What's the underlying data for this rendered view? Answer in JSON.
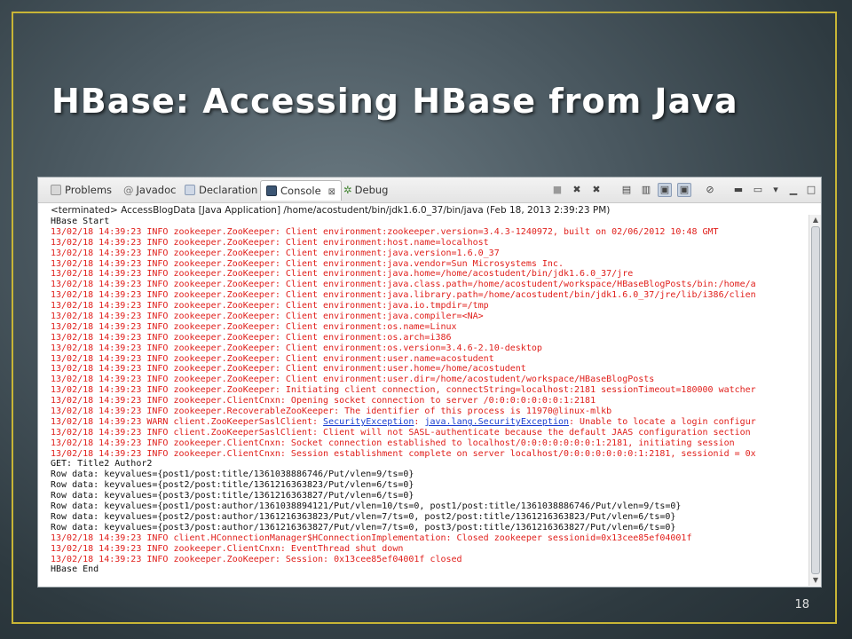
{
  "slide": {
    "title": "HBase: Accessing HBase from Java",
    "number": "18"
  },
  "eclipse": {
    "tabs": [
      {
        "label": "Problems",
        "icon": "problems-icon"
      },
      {
        "label": "Javadoc",
        "icon": "at-icon"
      },
      {
        "label": "Declaration",
        "icon": "declaration-icon"
      },
      {
        "label": "Console",
        "icon": "console-icon",
        "active": true,
        "close": "⊠"
      },
      {
        "label": "Debug",
        "icon": "debug-icon"
      }
    ],
    "terminated": "<terminated> AccessBlogData [Java Application] /home/acostudent/bin/jdk1.6.0_37/bin/java (Feb 18, 2013 2:39:23 PM)"
  },
  "console": {
    "colors": {
      "error": "#e0201c",
      "stdout": "#111111",
      "link": "#1b3fd1"
    },
    "lines": [
      {
        "type": "out",
        "text": "HBase Start"
      },
      {
        "type": "err",
        "text": "13/02/18 14:39:23 INFO zookeeper.ZooKeeper: Client environment:zookeeper.version=3.4.3-1240972, built on 02/06/2012 10:48 GMT"
      },
      {
        "type": "err",
        "text": "13/02/18 14:39:23 INFO zookeeper.ZooKeeper: Client environment:host.name=localhost"
      },
      {
        "type": "err",
        "text": "13/02/18 14:39:23 INFO zookeeper.ZooKeeper: Client environment:java.version=1.6.0_37"
      },
      {
        "type": "err",
        "text": "13/02/18 14:39:23 INFO zookeeper.ZooKeeper: Client environment:java.vendor=Sun Microsystems Inc."
      },
      {
        "type": "err",
        "text": "13/02/18 14:39:23 INFO zookeeper.ZooKeeper: Client environment:java.home=/home/acostudent/bin/jdk1.6.0_37/jre"
      },
      {
        "type": "err",
        "text": "13/02/18 14:39:23 INFO zookeeper.ZooKeeper: Client environment:java.class.path=/home/acostudent/workspace/HBaseBlogPosts/bin:/home/a"
      },
      {
        "type": "err",
        "text": "13/02/18 14:39:23 INFO zookeeper.ZooKeeper: Client environment:java.library.path=/home/acostudent/bin/jdk1.6.0_37/jre/lib/i386/clien"
      },
      {
        "type": "err",
        "text": "13/02/18 14:39:23 INFO zookeeper.ZooKeeper: Client environment:java.io.tmpdir=/tmp"
      },
      {
        "type": "err",
        "text": "13/02/18 14:39:23 INFO zookeeper.ZooKeeper: Client environment:java.compiler=<NA>"
      },
      {
        "type": "err",
        "text": "13/02/18 14:39:23 INFO zookeeper.ZooKeeper: Client environment:os.name=Linux"
      },
      {
        "type": "err",
        "text": "13/02/18 14:39:23 INFO zookeeper.ZooKeeper: Client environment:os.arch=i386"
      },
      {
        "type": "err",
        "text": "13/02/18 14:39:23 INFO zookeeper.ZooKeeper: Client environment:os.version=3.4.6-2.10-desktop"
      },
      {
        "type": "err",
        "text": "13/02/18 14:39:23 INFO zookeeper.ZooKeeper: Client environment:user.name=acostudent"
      },
      {
        "type": "err",
        "text": "13/02/18 14:39:23 INFO zookeeper.ZooKeeper: Client environment:user.home=/home/acostudent"
      },
      {
        "type": "err",
        "text": "13/02/18 14:39:23 INFO zookeeper.ZooKeeper: Client environment:user.dir=/home/acostudent/workspace/HBaseBlogPosts"
      },
      {
        "type": "err",
        "text": "13/02/18 14:39:23 INFO zookeeper.ZooKeeper: Initiating client connection, connectString=localhost:2181 sessionTimeout=180000 watcher"
      },
      {
        "type": "err",
        "text": "13/02/18 14:39:23 INFO zookeeper.ClientCnxn: Opening socket connection to server /0:0:0:0:0:0:0:1:2181"
      },
      {
        "type": "err",
        "text": "13/02/18 14:39:23 INFO zookeeper.RecoverableZooKeeper: The identifier of this process is 11970@linux-mlkb"
      },
      {
        "type": "err",
        "pre": "13/02/18 14:39:23 WARN client.ZooKeeperSaslClient: ",
        "link1": "SecurityException",
        "mid": ": ",
        "link2": "java.lang.SecurityException",
        "post": ": Unable to locate a login configur"
      },
      {
        "type": "err",
        "text": "13/02/18 14:39:23 INFO client.ZooKeeperSaslClient: Client will not SASL-authenticate because the default JAAS configuration section"
      },
      {
        "type": "err",
        "text": "13/02/18 14:39:23 INFO zookeeper.ClientCnxn: Socket connection established to localhost/0:0:0:0:0:0:0:1:2181, initiating session"
      },
      {
        "type": "err",
        "text": "13/02/18 14:39:23 INFO zookeeper.ClientCnxn: Session establishment complete on server localhost/0:0:0:0:0:0:0:1:2181, sessionid = 0x"
      },
      {
        "type": "out",
        "text": "GET: Title2 Author2"
      },
      {
        "type": "out",
        "text": "Row data: keyvalues={post1/post:title/1361038886746/Put/vlen=9/ts=0}"
      },
      {
        "type": "out",
        "text": "Row data: keyvalues={post2/post:title/1361216363823/Put/vlen=6/ts=0}"
      },
      {
        "type": "out",
        "text": "Row data: keyvalues={post3/post:title/1361216363827/Put/vlen=6/ts=0}"
      },
      {
        "type": "out",
        "text": "Row data: keyvalues={post1/post:author/1361038894121/Put/vlen=10/ts=0, post1/post:title/1361038886746/Put/vlen=9/ts=0}"
      },
      {
        "type": "out",
        "text": "Row data: keyvalues={post2/post:author/1361216363823/Put/vlen=7/ts=0, post2/post:title/1361216363823/Put/vlen=6/ts=0}"
      },
      {
        "type": "out",
        "text": "Row data: keyvalues={post3/post:author/1361216363827/Put/vlen=7/ts=0, post3/post:title/1361216363827/Put/vlen=6/ts=0}"
      },
      {
        "type": "err",
        "text": "13/02/18 14:39:23 INFO client.HConnectionManager$HConnectionImplementation: Closed zookeeper sessionid=0x13cee85ef04001f"
      },
      {
        "type": "err",
        "text": "13/02/18 14:39:23 INFO zookeeper.ClientCnxn: EventThread shut down"
      },
      {
        "type": "err",
        "text": "13/02/18 14:39:23 INFO zookeeper.ZooKeeper: Session: 0x13cee85ef04001f closed"
      },
      {
        "type": "out",
        "text": "HBase End"
      }
    ]
  },
  "toolbar_icons": [
    "terminate-icon",
    "remove-launch-icon",
    "remove-all-terminated-icon",
    "clear-console-icon",
    "scroll-lock-icon",
    "show-stdout-icon",
    "show-stderr-icon",
    "pin-console-icon",
    "display-selected-console-icon",
    "open-console-icon",
    "view-menu-icon",
    "minimize-icon",
    "maximize-icon"
  ]
}
